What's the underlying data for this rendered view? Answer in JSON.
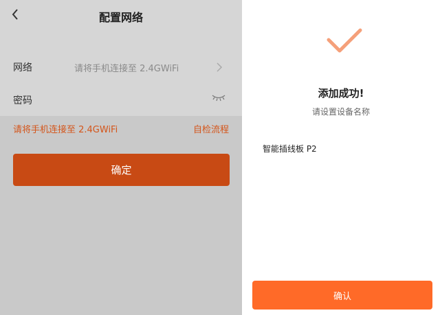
{
  "left_screen": {
    "title": "配置网络",
    "network_label": "网络",
    "network_value": "请将手机连接至 2.4GWiFi",
    "password_label": "密码",
    "hint_text": "请将手机连接至 2.4GWiFi",
    "self_check_label": "自检流程",
    "confirm_button": "确定",
    "accent_color": "#d4551a",
    "icons": [
      "back-arrow-icon",
      "chevron-right-icon",
      "eye-closed-icon"
    ]
  },
  "right_screen": {
    "success_title": "添加成功!",
    "subtitle": "请设置设备名称",
    "device_name_value": "智能插线板 P2",
    "ok_button": "确认",
    "accent_color": "#ff6a28",
    "icons": [
      "checkmark-icon"
    ]
  }
}
